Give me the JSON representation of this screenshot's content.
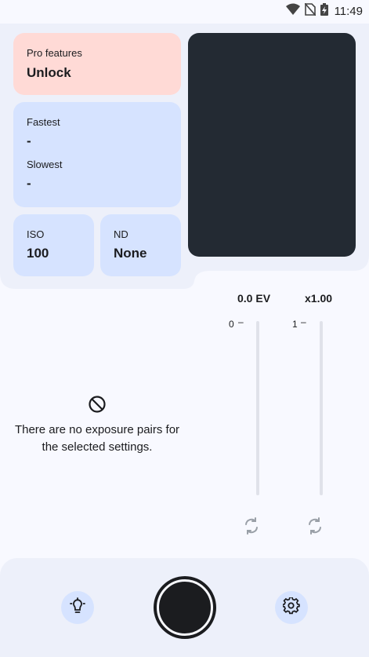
{
  "status_bar": {
    "time": "11:49",
    "icons": [
      "wifi-icon",
      "no-sim-icon",
      "battery-charging-icon"
    ]
  },
  "pro_card": {
    "label": "Pro features",
    "value": "Unlock"
  },
  "speed_card": {
    "fastest_label": "Fastest",
    "fastest_value": "-",
    "slowest_label": "Slowest",
    "slowest_value": "-"
  },
  "iso_card": {
    "label": "ISO",
    "value": "100"
  },
  "nd_card": {
    "label": "ND",
    "value": "None"
  },
  "empty_state": {
    "icon": "block-icon",
    "text_line1": "There are no exposure pairs for",
    "text_line2": "the selected settings."
  },
  "ev_slider": {
    "title": "0.0 EV",
    "tick": "0"
  },
  "zoom_slider": {
    "title": "x1.00",
    "tick": "1"
  },
  "bottom_bar": {
    "left_icon": "light-bulb-icon",
    "right_icon": "settings-gear-icon",
    "shutter": "shutter-button"
  },
  "colors": {
    "accent_container": "#d6e3ff",
    "pro_container": "#ffdad6",
    "preview_bg": "#232a33",
    "background": "#f8f9ff"
  }
}
